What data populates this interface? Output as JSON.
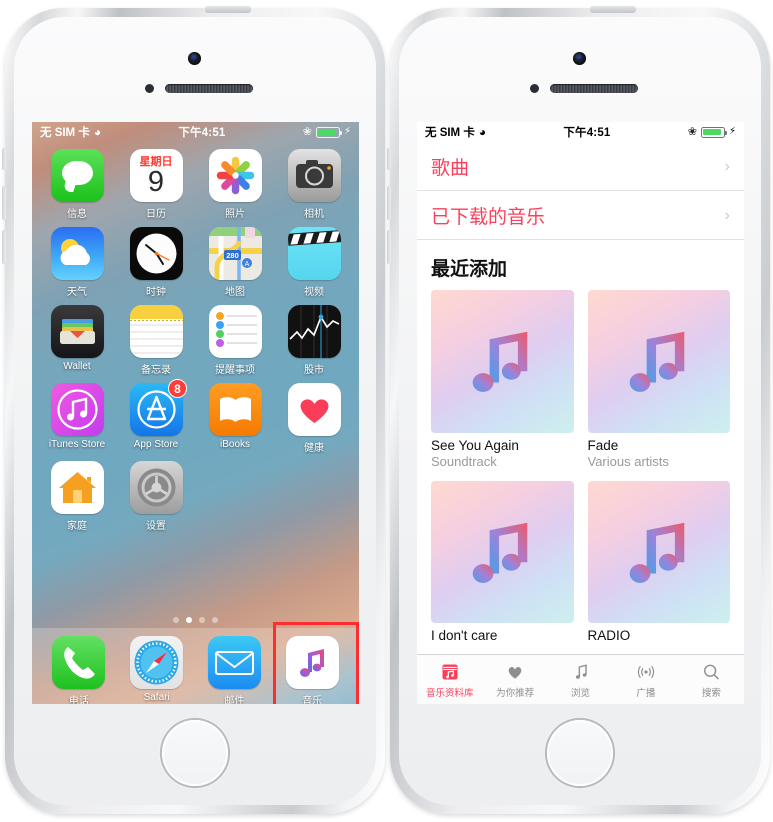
{
  "statusbar": {
    "carrier": "无 SIM 卡",
    "wifi_icon": "wifi-icon",
    "time": "下午4:51",
    "bluetooth_icon": "bluetooth-icon",
    "battery_icon": "battery-icon",
    "charging_icon": "charging-bolt-icon",
    "colors": {
      "battery_fill": "#4cd964"
    }
  },
  "home_screen": {
    "rows": [
      [
        {
          "label": "信息",
          "icon": "messages-icon"
        },
        {
          "label": "日历",
          "icon": "calendar-icon",
          "cal_weekday": "星期日",
          "cal_day": "9"
        },
        {
          "label": "照片",
          "icon": "photos-icon"
        },
        {
          "label": "相机",
          "icon": "camera-icon"
        }
      ],
      [
        {
          "label": "天气",
          "icon": "weather-icon"
        },
        {
          "label": "时钟",
          "icon": "clock-icon"
        },
        {
          "label": "地图",
          "icon": "maps-icon",
          "map_route": "280"
        },
        {
          "label": "视频",
          "icon": "videos-icon"
        }
      ],
      [
        {
          "label": "Wallet",
          "icon": "wallet-icon"
        },
        {
          "label": "备忘录",
          "icon": "notes-icon"
        },
        {
          "label": "提醒事项",
          "icon": "reminders-icon"
        },
        {
          "label": "股市",
          "icon": "stocks-icon"
        }
      ],
      [
        {
          "label": "iTunes Store",
          "icon": "itunes-store-icon"
        },
        {
          "label": "App Store",
          "icon": "app-store-icon",
          "badge": "8"
        },
        {
          "label": "iBooks",
          "icon": "ibooks-icon"
        },
        {
          "label": "健康",
          "icon": "health-icon"
        }
      ],
      [
        {
          "label": "家庭",
          "icon": "home-app-icon"
        },
        {
          "label": "设置",
          "icon": "settings-icon"
        }
      ]
    ],
    "page_dots": {
      "count": 4,
      "active_index": 1
    },
    "dock": [
      {
        "label": "电话",
        "icon": "phone-icon"
      },
      {
        "label": "Safari",
        "icon": "safari-icon"
      },
      {
        "label": "邮件",
        "icon": "mail-icon"
      },
      {
        "label": "音乐",
        "icon": "music-icon",
        "highlighted": true
      }
    ],
    "highlight_color": "#ff2d30"
  },
  "music_app": {
    "accent_color": "#fb3f5a",
    "list": [
      {
        "label": "歌曲",
        "chevron": "chevron-right-icon"
      },
      {
        "label": "已下载的音乐",
        "chevron": "chevron-right-icon"
      }
    ],
    "section_title": "最近添加",
    "albums": [
      {
        "title": "See You Again",
        "subtitle": "Soundtrack"
      },
      {
        "title": "Fade",
        "subtitle": "Various artists"
      },
      {
        "title": "I don't care",
        "subtitle": ""
      },
      {
        "title": "RADIO",
        "subtitle": ""
      }
    ],
    "tabs": [
      {
        "label": "音乐资料库",
        "icon": "library-icon",
        "active": true
      },
      {
        "label": "为你推荐",
        "icon": "heart-icon",
        "active": false
      },
      {
        "label": "浏览",
        "icon": "note-icon",
        "active": false
      },
      {
        "label": "广播",
        "icon": "radio-waves-icon",
        "active": false
      },
      {
        "label": "搜索",
        "icon": "search-icon",
        "active": false
      }
    ]
  }
}
